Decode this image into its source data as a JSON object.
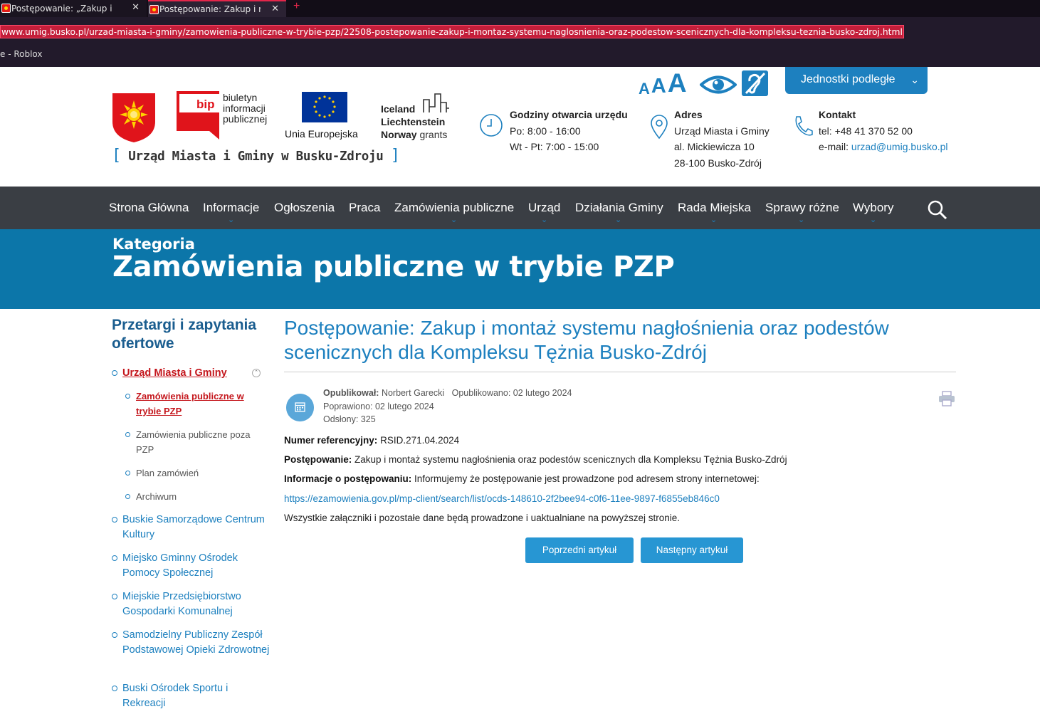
{
  "browser": {
    "tabs": [
      {
        "title": "Postępowanie: „Zakup i mo"
      },
      {
        "title": "Postępowanie: Zakup i mon"
      }
    ],
    "close_glyph": "✕",
    "new_tab_glyph": "+",
    "url": "www.umig.busko.pl/urzad-miasta-i-gminy/zamowienia-publiczne-w-trybie-pzp/22508-postepowanie-zakup-i-montaz-systemu-naglosnienia-oraz-podestow-scenicznych-dla-kompleksu-teznia-busko-zdroj.html",
    "bookmark": "e - Roblox"
  },
  "header": {
    "bip_lines": [
      "biuletyn",
      "informacji",
      "publicznej"
    ],
    "bip_logo": "bip",
    "eu_label": "Unia Europejska",
    "grants_lines": [
      "Iceland",
      "Liechtenstein",
      "Norway"
    ],
    "grants_word": "grants",
    "office_name": "Urząd Miasta i Gminy w Busku-Zdroju",
    "bracket_open": "[",
    "bracket_close": "]",
    "font_sizes": [
      "A",
      "A",
      "A"
    ],
    "units_button": "Jednostki podległe",
    "chevron": "⌄",
    "hours": {
      "heading": "Godziny otwarcia urzędu",
      "lines": [
        "Po: 8:00 - 16:00",
        "Wt - Pt: 7:00 - 15:00"
      ]
    },
    "address": {
      "heading": "Adres",
      "lines": [
        "Urząd Miasta i Gminy",
        "al. Mickiewicza 10",
        "28-100 Busko-Zdrój"
      ]
    },
    "contact": {
      "heading": "Kontakt",
      "phone": "tel: +48 41 370 52 00",
      "email_label": "e-mail: ",
      "email": "urzad@umig.busko.pl"
    }
  },
  "nav": {
    "items": [
      "Strona Główna",
      "Informacje",
      "Ogłoszenia",
      "Praca",
      "Zamówienia publiczne",
      "Urząd",
      "Działania Gminy",
      "Rada Miejska",
      "Sprawy różne",
      "Wybory"
    ],
    "caret": "⌄"
  },
  "banner": {
    "label": "Kategoria",
    "title": "Zamówienia publiczne w trybie PZP"
  },
  "sidebar": {
    "title": "Przetargi i zapytania ofertowe",
    "collapse_glyph": "⌃",
    "items": [
      {
        "label": "Urząd Miasta i Gminy"
      },
      {
        "label": "Buskie Samorządowe Centrum Kultury"
      },
      {
        "label": "Miejsko Gminny Ośrodek Pomocy Społecznej"
      },
      {
        "label": "Miejskie Przedsiębiorstwo Gospodarki Komunalnej"
      },
      {
        "label": "Samodzielny Publiczny Zespół Podstawowej Opieki Zdrowotnej"
      },
      {
        "label": "Buski Ośrodek Sportu i Rekreacji"
      }
    ],
    "subitems": [
      {
        "label": "Zamówienia publiczne w trybie PZP"
      },
      {
        "label": "Zamówienia publiczne poza PZP"
      },
      {
        "label": "Plan zamówień"
      },
      {
        "label": "Archiwum"
      }
    ]
  },
  "article": {
    "title": "Postępowanie: Zakup i montaż systemu nagłośnienia oraz podestów scenicznych dla Kompleksu Tężnia Busko-Zdrój",
    "meta": {
      "author_label": "Opublikował: ",
      "author": "Norbert Garecki",
      "published": "Opublikowano: 02 lutego 2024",
      "modified": "Poprawiono: 02 lutego 2024",
      "hits": "Odsłony: 325"
    },
    "ref_label": "Numer referencyjny:",
    "ref_value": " RSID.271.04.2024",
    "proc_label": "Postępowanie:",
    "proc_value": " Zakup i montaż systemu nagłośnienia oraz podestów scenicznych dla Kompleksu Tężnia Busko-Zdrój",
    "info_label": "Informacje o postępowaniu:",
    "info_value": " Informujemy że postępowanie jest prowadzone pod adresem strony internetowej:",
    "link": "https://ezamowienia.gov.pl/mp-client/search/list/ocds-148610-2f2bee94-c0f6-11ee-9897-f6855eb846c0",
    "footer_text": "Wszystkie załączniki i pozostałe dane będą prowadzone i uaktualniane na powyższej stronie.",
    "prev": "Poprzedni artykuł",
    "next": "Następny artykuł"
  },
  "colors": {
    "accent": "#1d80bf",
    "banner": "#0c76a9",
    "nav": "#3a3e44",
    "active": "#c4161c"
  }
}
